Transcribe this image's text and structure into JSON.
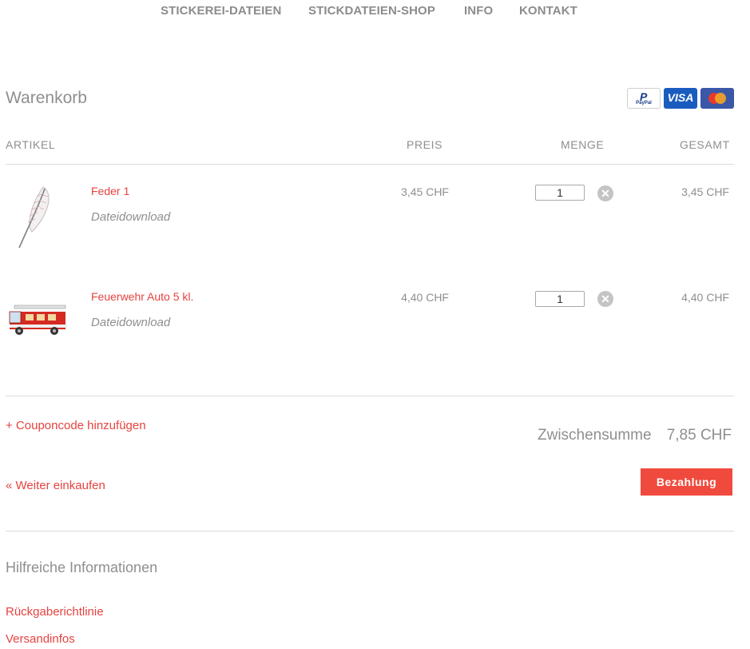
{
  "nav": {
    "items": [
      "STICKEREI-DATEIEN",
      "STICKDATEIEN-SHOP",
      "INFO",
      "KONTAKT"
    ]
  },
  "cart": {
    "title": "Warenkorb",
    "payment_icons": [
      "paypal-icon",
      "visa-icon",
      "mastercard-icon"
    ],
    "paypal_letter": "P",
    "paypal_text": "PayPal",
    "visa_text": "VISA"
  },
  "table": {
    "headers": {
      "article": "ARTIKEL",
      "price": "PREIS",
      "quantity": "MENGE",
      "total": "GESAMT"
    },
    "items": [
      {
        "name": "Feder 1",
        "subtitle": "Dateidownload",
        "price": "3,45 CHF",
        "quantity": "1",
        "total": "3,45 CHF",
        "image": "feather-embroidery-image"
      },
      {
        "name": "Feuerwehr Auto 5 kl.",
        "subtitle": "Dateidownload",
        "price": "4,40 CHF",
        "quantity": "1",
        "total": "4,40 CHF",
        "image": "fire-truck-embroidery-image"
      }
    ],
    "remove_symbol": "✕"
  },
  "footer": {
    "coupon_link": "+ Couponcode hinzufügen",
    "subtotal_label": "Zwischensumme",
    "subtotal_value": "7,85 CHF",
    "continue_link": "« Weiter einkaufen",
    "checkout_button": "Bezahlung"
  },
  "info": {
    "title": "Hilfreiche Informationen",
    "links": [
      "Rückgaberichtlinie",
      "Versandinfos"
    ]
  },
  "colors": {
    "accent": "#e5433f",
    "button": "#f04a3e",
    "text": "#8f8f8f",
    "rule": "#dcdcdc"
  }
}
